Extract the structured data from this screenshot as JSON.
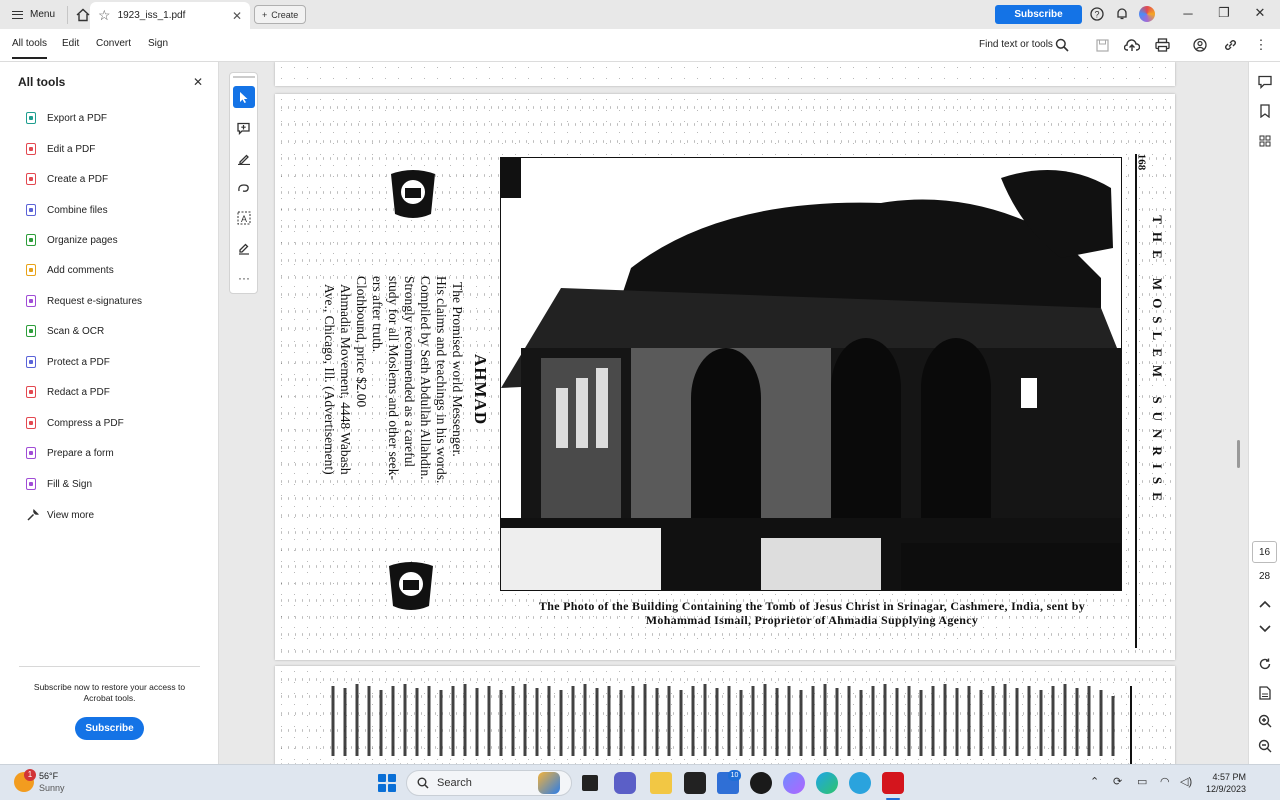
{
  "titlebar": {
    "menu_label": "Menu",
    "tab_label": "1923_iss_1.pdf",
    "create_label": "Create",
    "subscribe_label": "Subscribe"
  },
  "toolbar": {
    "tabs": [
      "All tools",
      "Edit",
      "Convert",
      "Sign"
    ],
    "find_label": "Find text or tools"
  },
  "left_panel": {
    "title": "All tools",
    "items": [
      {
        "label": "Export a PDF",
        "color": "#1e9e8f"
      },
      {
        "label": "Edit a PDF",
        "color": "#e34850"
      },
      {
        "label": "Create a PDF",
        "color": "#e34850"
      },
      {
        "label": "Combine files",
        "color": "#5a63d8"
      },
      {
        "label": "Organize pages",
        "color": "#2d9d3a"
      },
      {
        "label": "Add comments",
        "color": "#e8a317"
      },
      {
        "label": "Request e-signatures",
        "color": "#a04cd6"
      },
      {
        "label": "Scan & OCR",
        "color": "#2d9d3a"
      },
      {
        "label": "Protect a PDF",
        "color": "#5a63d8"
      },
      {
        "label": "Redact a PDF",
        "color": "#e34850"
      },
      {
        "label": "Compress a PDF",
        "color": "#e34850"
      },
      {
        "label": "Prepare a form",
        "color": "#a04cd6"
      },
      {
        "label": "Fill & Sign",
        "color": "#a04cd6"
      }
    ],
    "view_more": "View more",
    "subscribe_text": "Subscribe now to restore your access to Acrobat tools.",
    "subscribe_button": "Subscribe"
  },
  "document": {
    "page_number_printed": "168",
    "running_head": "THE MOSLEM SUNRISE",
    "ad_title": "AHMAD",
    "ad_lines": [
      "The Promised world Messenger.",
      "His claims and teachings in his words.",
      "Compiled by Seth Abdullah Allahdin.",
      "Strongly recommended as a careful",
      "study for all Moslems and other seek-",
      "ers after truth.",
      "Clothbound, price $2.00",
      "Ahmadia Movement, 4448 Wabash",
      "Ave., Chicago, Ill. (Advertisement)"
    ],
    "caption_line1": "The Photo of the Building Containing the Tomb of Jesus Christ in Srinagar, Cashmere, India, sent by",
    "caption_line2": "Mohammad Ismail, Proprietor of Ahmadia Supplying Agency"
  },
  "page_nav": {
    "current": "16",
    "total": "28"
  },
  "taskbar": {
    "temp": "56°F",
    "weather": "Sunny",
    "weather_badge": "1",
    "search_label": "Search",
    "mail_badge": "10",
    "time": "4:57 PM",
    "date": "12/9/2023"
  }
}
